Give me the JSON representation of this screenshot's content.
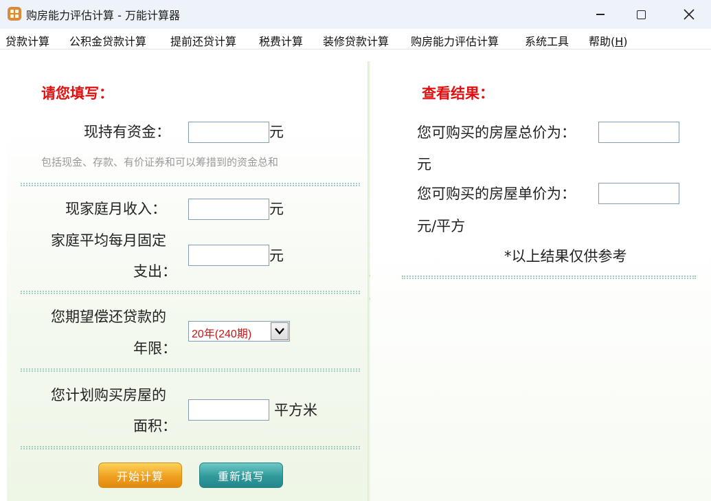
{
  "window": {
    "title": "购房能力评估计算 - 万能计算器"
  },
  "menu": {
    "items": [
      "贷款计算",
      "公积金贷款计算",
      "提前还贷计算",
      "税费计算",
      "装修贷款计算",
      "购房能力评估计算",
      "系统工具"
    ],
    "help_prefix": "帮助(",
    "help_key": "H",
    "help_suffix": ")"
  },
  "form": {
    "heading": "请您填写：",
    "funds_label": "现持有资金：",
    "funds_value": "",
    "funds_unit": "元",
    "funds_hint": "包括现金、存款、有价证券和可以筹措到的资金总和",
    "income_label": "现家庭月收入：",
    "income_value": "",
    "income_unit": "元",
    "expense_label_line1": "家庭平均每月固定",
    "expense_label_line2": "支出：",
    "expense_value": "",
    "expense_unit": "元",
    "years_label_line1": "您期望偿还贷款的",
    "years_label_line2": "年限：",
    "years_selected": "20年(240期)",
    "area_label_line1": "您计划购买房屋的",
    "area_label_line2": "面积：",
    "area_value": "",
    "area_unit": "平方米",
    "start_button": "开始计算",
    "reset_button": "重新填写"
  },
  "result": {
    "heading": "查看结果：",
    "total_label": "您可购买的房屋总价为：",
    "total_value": "",
    "total_unit": "元",
    "unit_price_label": "您可购买的房屋单价为：",
    "unit_price_value": "",
    "unit_price_unit": "元/平方",
    "note": "*以上结果仅供参考"
  },
  "colors": {
    "heading_red": "#e01010",
    "separator": "#9fd0c4",
    "start_button": "#f0a020",
    "reset_button": "#2f9a9c"
  }
}
